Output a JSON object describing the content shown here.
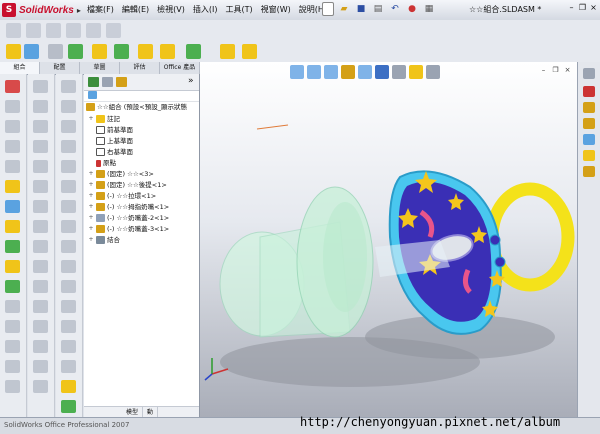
{
  "app": {
    "name": "SolidWorks",
    "doc_title": "☆☆組合.SLDASM *"
  },
  "menu": [
    "檔案(F)",
    "編輯(E)",
    "檢視(V)",
    "插入(I)",
    "工具(T)",
    "視窗(W)",
    "說明(H)"
  ],
  "command_tabs": [
    "組合",
    "配置",
    "草圖",
    "評估",
    "Office 產品"
  ],
  "feature_tree": {
    "root": "☆☆組合 (預設<預設_顯示狀態",
    "items": [
      {
        "label": "註記",
        "expand": "+"
      },
      {
        "label": "前基準面",
        "expand": ""
      },
      {
        "label": "上基準面",
        "expand": ""
      },
      {
        "label": "右基準面",
        "expand": ""
      },
      {
        "label": "原點",
        "expand": ""
      },
      {
        "label": "(固定) ☆☆<3>",
        "expand": "+"
      },
      {
        "label": "(固定) ☆☆後提<1>",
        "expand": "+"
      },
      {
        "label": "(-) ☆☆拉環<1>",
        "expand": "+"
      },
      {
        "label": "(-) ☆☆拇指奶嘴<1>",
        "expand": "+"
      },
      {
        "label": "(-) ☆☆奶嘴蓋-2<1>",
        "expand": "+"
      },
      {
        "label": "(-) ☆☆奶嘴蓋-3<1>",
        "expand": "+"
      },
      {
        "label": "結合",
        "expand": "+"
      }
    ]
  },
  "fm_bottom_tabs": [
    "模型",
    "動"
  ],
  "status": {
    "text": "SolidWorks Office Professional 2007"
  },
  "watermark": "http://chenyongyuan.pixnet.net/album",
  "colors": {
    "star_yellow": "#f4c51c",
    "shield_blue": "#3a2fb5",
    "rim_cyan": "#49c7ef",
    "ring_yellow": "#f4e21a",
    "nipple_mint": "#c9f2dc"
  }
}
